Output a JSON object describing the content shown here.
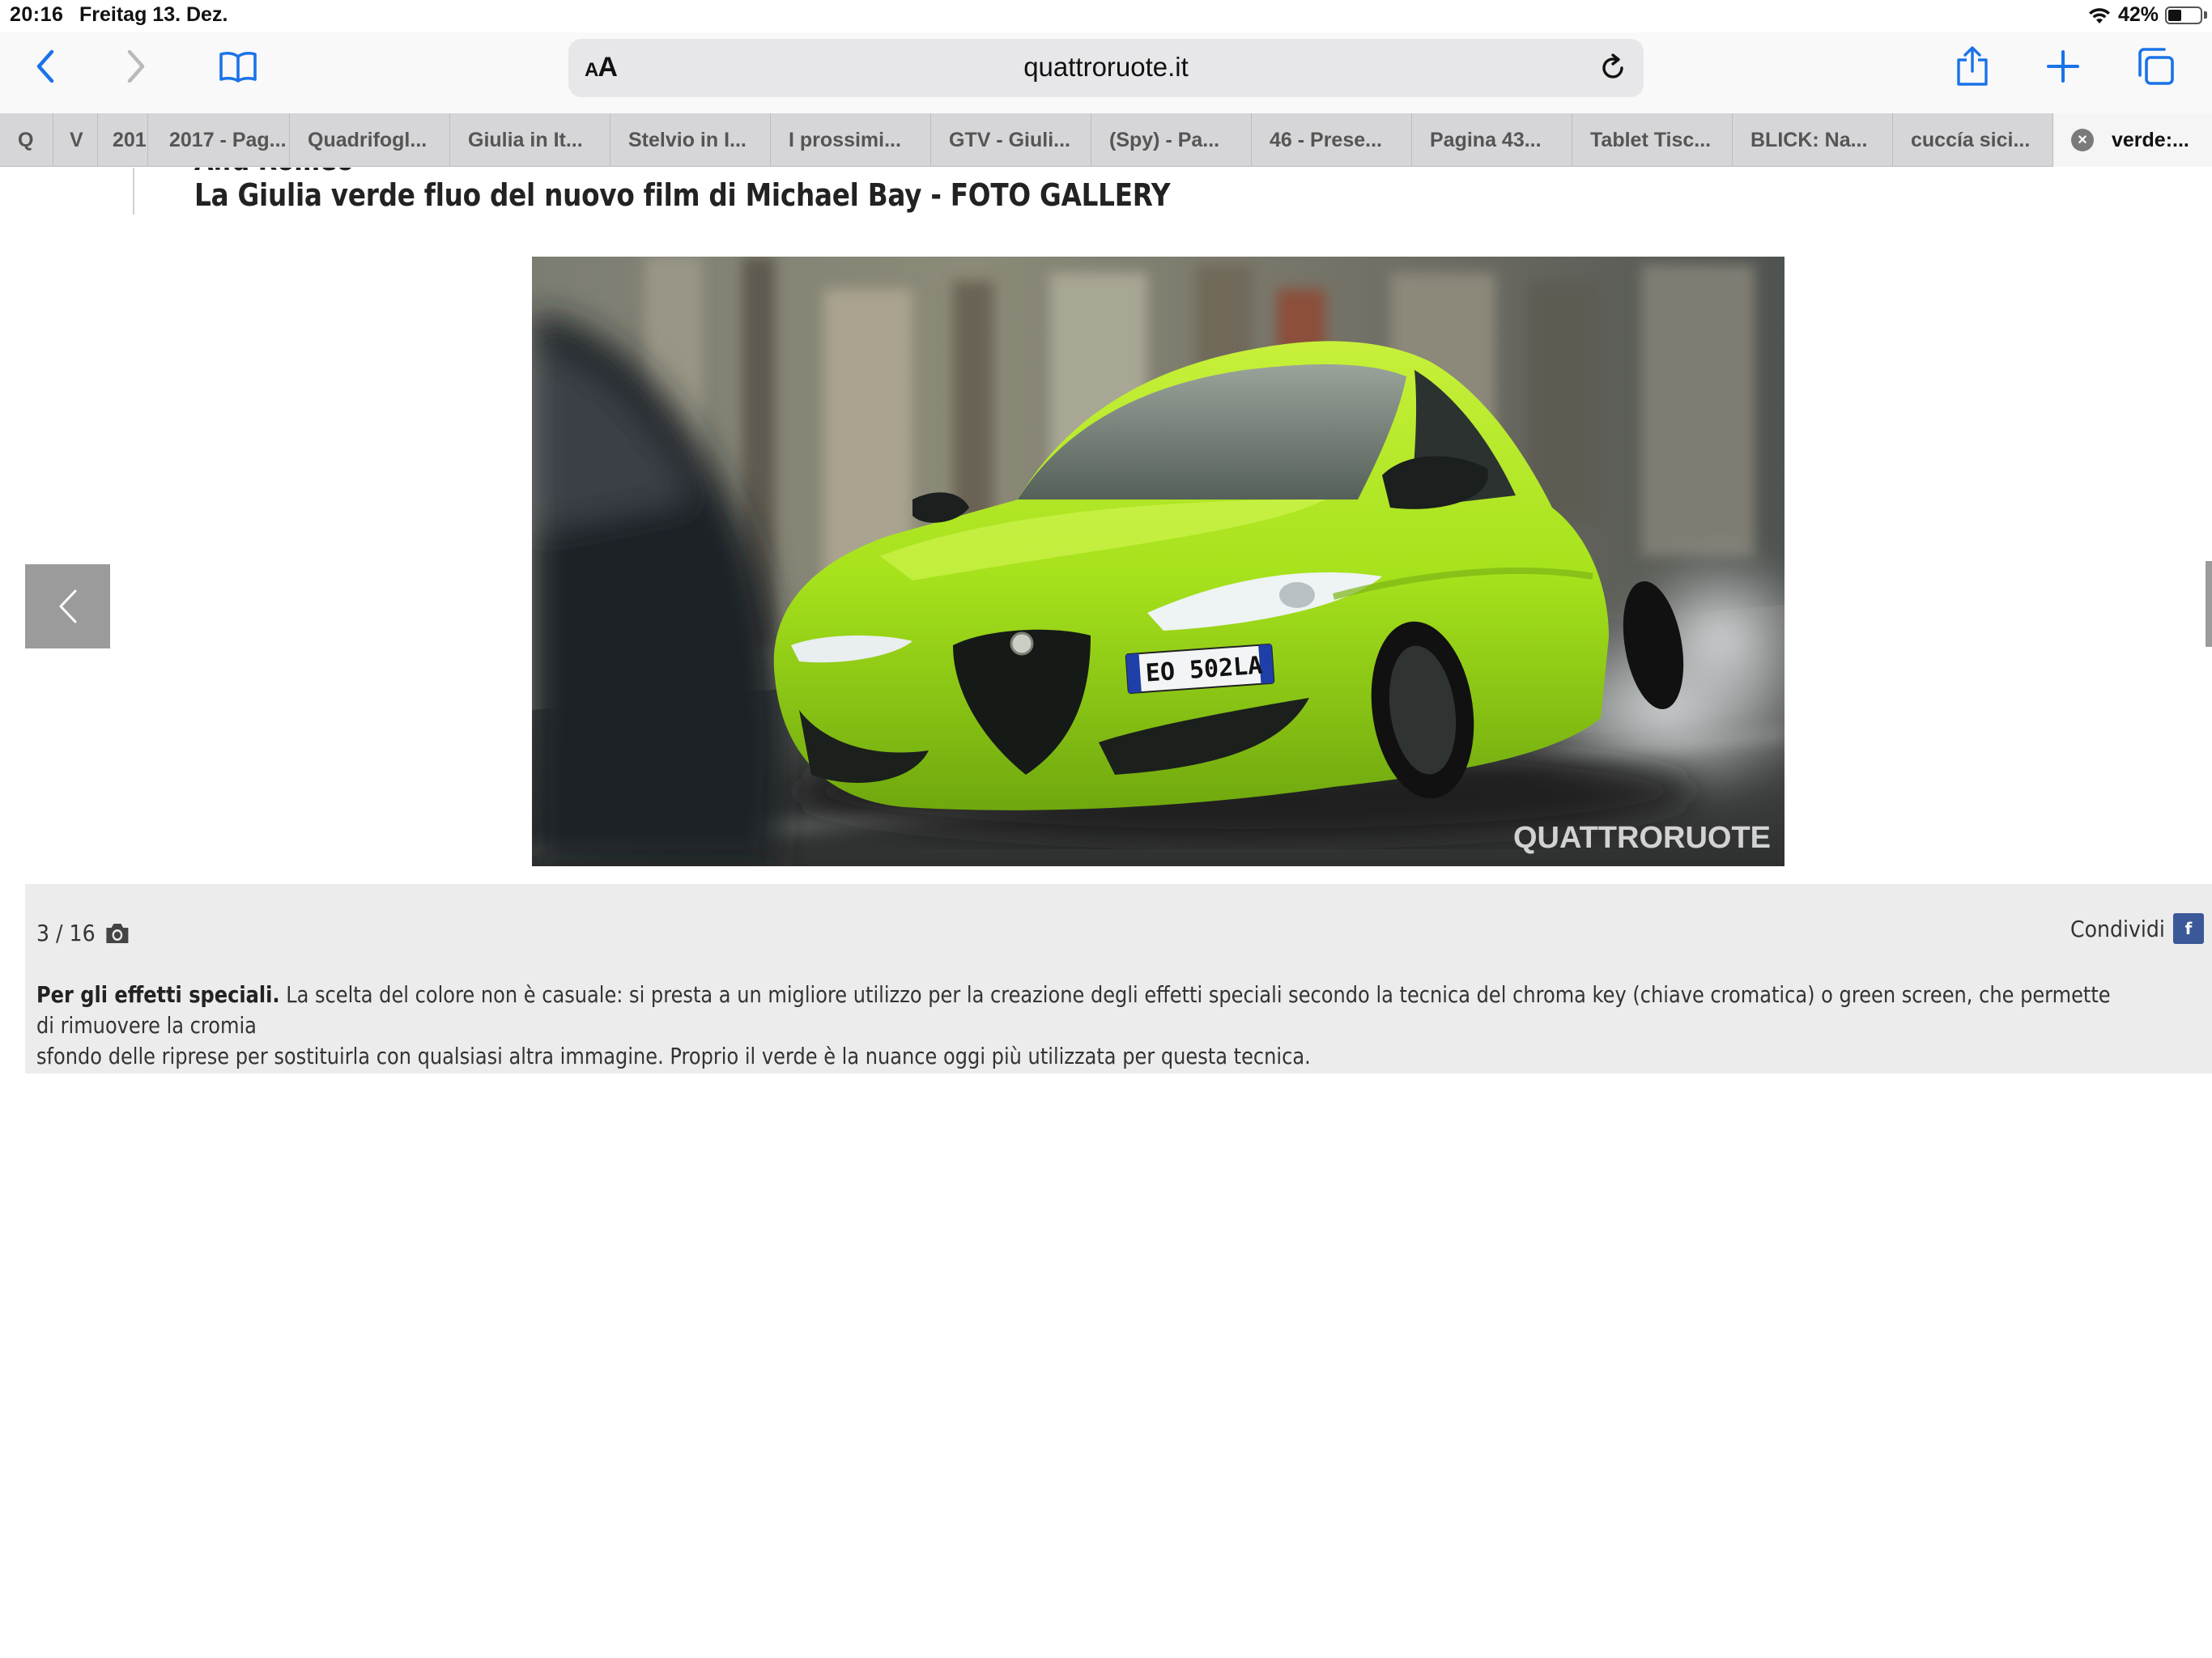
{
  "status_bar": {
    "time": "20:16",
    "date": "Freitag 13. Dez.",
    "battery": "42%",
    "battery_level": 0.42
  },
  "toolbar": {
    "text_size_label": "AA",
    "url": "quattroruote.it"
  },
  "tabs": [
    {
      "label": "Q"
    },
    {
      "label": "V"
    },
    {
      "label": "201"
    },
    {
      "label": "2017 - Pag..."
    },
    {
      "label": "Quadrifogl..."
    },
    {
      "label": "Giulia in It..."
    },
    {
      "label": "Stelvio in I..."
    },
    {
      "label": "I prossimi..."
    },
    {
      "label": "GTV - Giuli..."
    },
    {
      "label": "(Spy) - Pa..."
    },
    {
      "label": "46 - Prese..."
    },
    {
      "label": "Pagina 43..."
    },
    {
      "label": "Tablet Tisc..."
    },
    {
      "label": "BLICK: Na..."
    },
    {
      "label": "cuccía sici..."
    },
    {
      "label": "verde:..."
    }
  ],
  "article": {
    "kicker": "Alfa Romeo",
    "headline": "La Giulia verde fluo del nuovo film di Michael Bay - FOTO GALLERY"
  },
  "gallery": {
    "image_watermark": "QUATTRORUOTE",
    "plate": "EO 502LA",
    "counter": "3 / 16",
    "share_label": "Condividi",
    "facebook_glyph": "f",
    "caption_bold": "Per gli effetti speciali.",
    "caption_line1": "La scelta del colore non è casuale: si presta a un migliore utilizzo per la creazione degli effetti speciali secondo la tecnica del chroma key (chiave cromatica) o green screen, che permette di rimuovere la cromia",
    "caption_line2": "sfondo delle riprese per sostituirla con qualsiasi altra immagine. Proprio il verde è la nuance oggi più utilizzata per questa tecnica."
  },
  "colors": {
    "accent_blue": "#1a73e8",
    "car_green": "#a6e21c",
    "facebook": "#3b5998"
  }
}
